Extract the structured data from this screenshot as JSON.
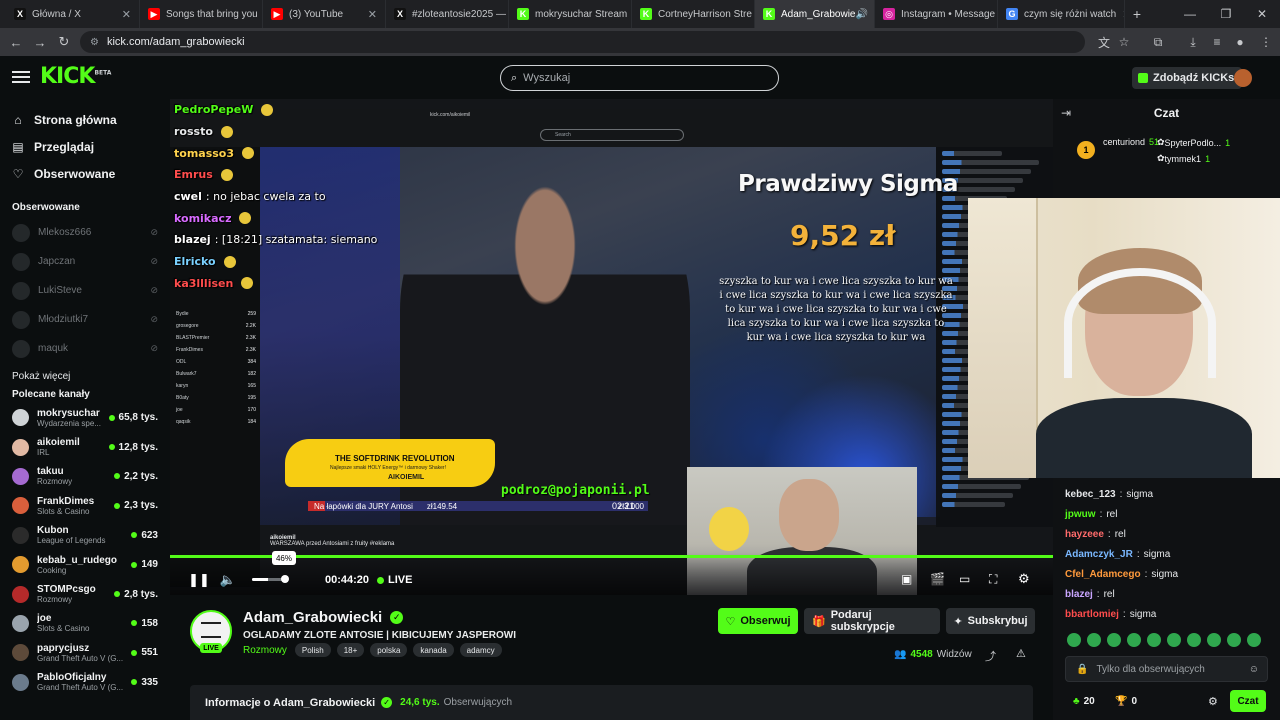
{
  "browser": {
    "tabs": [
      {
        "title": "Główna / X",
        "color": "#111111",
        "glyph": "X"
      },
      {
        "title": "Songs that bring you",
        "color": "#ff0000",
        "glyph": "▶"
      },
      {
        "title": "(3) YouTube",
        "color": "#ff0000",
        "glyph": "▶"
      },
      {
        "title": "#zloteantosie2025 —",
        "color": "#111111",
        "glyph": "X"
      },
      {
        "title": "mokrysuchar Stream",
        "color": "#53fc18",
        "glyph": "K"
      },
      {
        "title": "CortneyHarrison Stre",
        "color": "#53fc18",
        "glyph": "K"
      },
      {
        "title": "Adam_Grabowie",
        "color": "#53fc18",
        "glyph": "K"
      },
      {
        "title": "Instagram • Message",
        "color": "#d6249f",
        "glyph": "◎"
      },
      {
        "title": "czym się różni watch",
        "color": "#4285f4",
        "glyph": "G"
      }
    ],
    "url": "kick.com/adam_grabowiecki"
  },
  "header": {
    "logo": "KICK",
    "logo_badge": "BETA",
    "search_placeholder": "Wyszukaj",
    "get_kicks": "Zdobądź KICKs"
  },
  "sidebar": {
    "nav": [
      {
        "label": "Strona główna",
        "icon": "home-icon",
        "glyph": "⌂"
      },
      {
        "label": "Przeglądaj",
        "icon": "browse-icon",
        "glyph": "▤"
      },
      {
        "label": "Obserwowane",
        "icon": "heart-icon",
        "glyph": "♡"
      }
    ],
    "followed_heading": "Obserwowane",
    "followed": [
      {
        "name": "Mlekosz666"
      },
      {
        "name": "Japczan"
      },
      {
        "name": "LukiSteve"
      },
      {
        "name": "Młodziutki7"
      },
      {
        "name": "maquk"
      }
    ],
    "show_more": "Pokaż więcej",
    "recommended_heading": "Polecane kanały",
    "recommended": [
      {
        "name": "mokrysuchar",
        "category": "Wydarzenia spe...",
        "viewers": "65,8 tys.",
        "color": "#cfd3d6"
      },
      {
        "name": "aikoiemil",
        "category": "IRL",
        "viewers": "12,8 tys.",
        "color": "#e1b9a4"
      },
      {
        "name": "takuu",
        "category": "Rozmowy",
        "viewers": "2,2 tys.",
        "color": "#a56ad1"
      },
      {
        "name": "FrankDimes",
        "category": "Slots & Casino",
        "viewers": "2,3 tys.",
        "color": "#d95f3c"
      },
      {
        "name": "Kubon",
        "category": "League of Legends",
        "viewers": "623",
        "color": "#2b2b2b"
      },
      {
        "name": "kebab_u_rudego",
        "category": "Cooking",
        "viewers": "149",
        "color": "#e39b2f"
      },
      {
        "name": "STOMPcsgo",
        "category": "Rozmowy",
        "viewers": "2,8 tys.",
        "color": "#b52a2a"
      },
      {
        "name": "joe",
        "category": "Slots & Casino",
        "viewers": "158",
        "color": "#9aa4ad"
      },
      {
        "name": "paprycjusz",
        "category": "Grand Theft Auto V (G...",
        "viewers": "551",
        "color": "#5d4a3a"
      },
      {
        "name": "PabloOficjalny",
        "category": "Grand Theft Auto V (G...",
        "viewers": "335",
        "color": "#6b7b8c"
      }
    ]
  },
  "player": {
    "overlay_chat": [
      {
        "user": "PedroPepeW",
        "message": "",
        "color": "#53fc18"
      },
      {
        "user": "rossto",
        "message": "",
        "color": "#e6e8ea"
      },
      {
        "user": "tomasso3",
        "message": "",
        "color": "#ffd34d"
      },
      {
        "user": "Emrus",
        "message": "",
        "color": "#ff4d4d"
      },
      {
        "user": "cwel",
        "message": ": no jebac cwela za to",
        "color": "#ffffff"
      },
      {
        "user": "komikacz",
        "message": "",
        "color": "#d86bff"
      },
      {
        "user": "blazej",
        "message": ": [18:21]  szatamata: siemano",
        "color": "#ffffff"
      },
      {
        "user": "Elricko",
        "message": "",
        "color": "#7ad1ff"
      },
      {
        "user": "ka3lllisen",
        "message": "",
        "color": "#ff4d4d"
      }
    ],
    "mini_recommended": [
      {
        "name": "Bydie",
        "v": "259"
      },
      {
        "name": "grosegore",
        "v": "2.2K"
      },
      {
        "name": "BLASTPremier",
        "v": "2.3K"
      },
      {
        "name": "FrankDimes",
        "v": "2.3K"
      },
      {
        "name": "ODL",
        "v": "384"
      },
      {
        "name": "Bulwark7",
        "v": "182"
      },
      {
        "name": "karyn",
        "v": "165"
      },
      {
        "name": "B0aty",
        "v": "195"
      },
      {
        "name": "joe",
        "v": "170"
      },
      {
        "name": "qaqsik",
        "v": "184"
      }
    ],
    "mini_url": "kick.com/aikoiemil",
    "mini_search": "Search",
    "donation_title": "Prawdziwy Sigma",
    "donation_amount": "9,52 zł",
    "donation_message": "szyszka to kur wa i cwe lica szyszka to kur wa i cwe lica szyszka to kur wa i cwe lica szyszka to kur wa i cwe lica szyszka to kur wa i cwe lica szyszka to kur wa i cwe lica szyszka to kur wa i cwe lica szyszka to kur wa",
    "email_overlay": "podroz@pojaponii.pl",
    "jury_label": "Na łapówki dla JURY Antosi",
    "jury_amount": "zł149.54",
    "jury_goal": "zł3.000",
    "jury_progress": 0.05,
    "countdown": "02:21",
    "promo_title": "THE SOFTDRINK REVOLUTION",
    "promo_subtitle": "Najlepsze smaki HOLY Energy™ i darmowy Shaker!",
    "promo_name": "AIKOIEMIL",
    "mini_channel_name": "aikoiemil",
    "mini_channel_title": "WARSZAWA przed Antosiami z fruity #reklama",
    "volume_percent": 46,
    "volume_label": "46%",
    "time": "00:44:20",
    "live_label": "LIVE",
    "progress": 1.0
  },
  "channel": {
    "name": "Adam_Grabowiecki",
    "title": "OGLADAMY ZLOTE ANTOSIE | KIBICUJEMY JASPEROWI",
    "category": "Rozmowy",
    "tags": [
      "Polish",
      "18+",
      "polska",
      "kanada",
      "adamcy"
    ],
    "live_badge": "LIVE",
    "follow": "Obserwuj",
    "gift": "Podaruj subskrypcje",
    "subscribe": "Subskrybuj",
    "viewers": "4548",
    "viewers_label": "Widzów",
    "about": "Informacje o Adam_Grabowiecki",
    "followers": "24,6 tys.",
    "followers_label": "Obserwujących"
  },
  "chat": {
    "title": "Czat",
    "top_gifters": [
      {
        "name": "centuriond",
        "count": "51"
      },
      {
        "name": "SpyterPodlo...",
        "count": "1"
      },
      {
        "name": "tymmek1",
        "count": "1"
      }
    ],
    "rank": "1",
    "messages": [
      {
        "user": "kebec_123",
        "text": "sigma",
        "color": "#e6e8ea"
      },
      {
        "user": "jpwuw",
        "text": "rel",
        "color": "#53fc18"
      },
      {
        "user": "hayzeee",
        "text": "rel",
        "color": "#ff6b6b"
      },
      {
        "user": "Adamczyk_JR",
        "text": "sigma",
        "color": "#7ab8ff"
      },
      {
        "user": "Cfel_Adamcego",
        "text": "sigma",
        "color": "#ff9a3c"
      },
      {
        "user": "blazej",
        "text": "rel",
        "color": "#c9a6ff"
      },
      {
        "user": "bbartlomiej",
        "text": "sigma",
        "color": "#ff4d4d"
      }
    ],
    "input_placeholder": "Tylko dla obserwujących",
    "points": "20",
    "points2": "0",
    "send": "Czat"
  }
}
